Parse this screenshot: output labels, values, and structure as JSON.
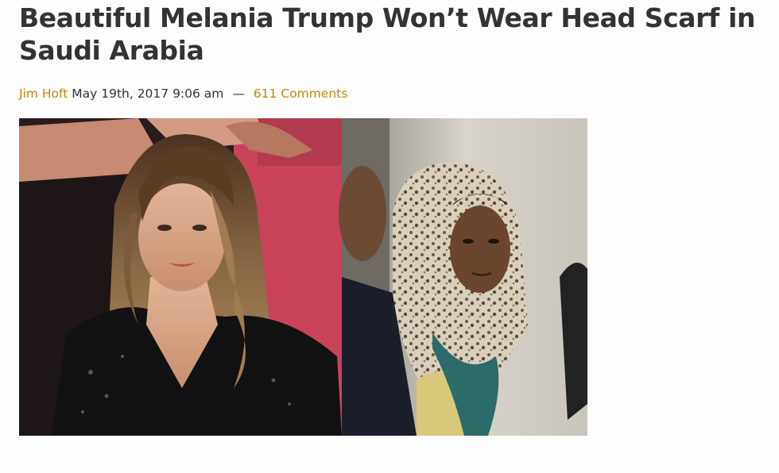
{
  "article": {
    "title": "Beautiful Melania Trump Won’t Wear Head Scarf in Saudi Arabia",
    "author": "Jim Hoft",
    "date": "May 19th, 2017 9:06 am",
    "separator": "—",
    "comments": "611 Comments",
    "link_color": "#c7860a"
  },
  "figure": {
    "left_photo": "portrait-woman-black-jacket",
    "right_photo": "portrait-woman-leopard-headscarf"
  }
}
